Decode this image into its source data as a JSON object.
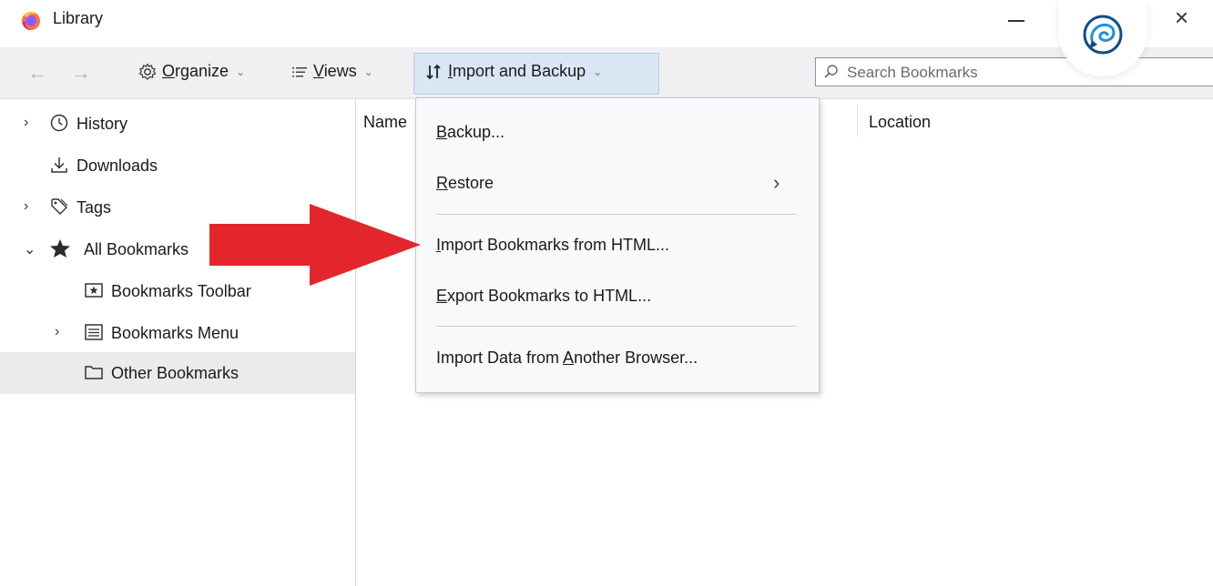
{
  "window": {
    "title": "Library",
    "app_icon": "firefox-icon",
    "controls": {
      "minimize": "minimize-icon",
      "close": "×"
    },
    "assistant_badge_icon": "assistant-chat-icon"
  },
  "toolbar": {
    "back_icon": "←",
    "forward_icon": "→",
    "organize": {
      "icon": "gear-icon",
      "label_first": "O",
      "label_rest": "rganize",
      "caret": "⌄"
    },
    "views": {
      "icon": "views-list-icon",
      "label_first": "V",
      "label_rest": "iews",
      "caret": "⌄"
    },
    "import_backup": {
      "icon": "sort-arrows-icon",
      "label_first": "I",
      "label_rest": "mport and Backup",
      "caret": "⌄",
      "active": true
    },
    "search": {
      "placeholder": "Search Bookmarks",
      "value": "",
      "icon": "search-icon"
    }
  },
  "sidebar": {
    "items": [
      {
        "label": "History",
        "icon": "clock-icon",
        "twisty": "›",
        "selected": false
      },
      {
        "label": "Downloads",
        "icon": "download-icon",
        "twisty": "",
        "selected": false
      },
      {
        "label": "Tags",
        "icon": "tag-icon",
        "twisty": "›",
        "selected": false
      },
      {
        "label": "All Bookmarks",
        "icon": "star-icon",
        "twisty": "⌄",
        "selected": false
      },
      {
        "label": "Bookmarks Toolbar",
        "icon": "toolbar-icon",
        "twisty": "",
        "selected": false
      },
      {
        "label": "Bookmarks Menu",
        "icon": "menu-list-icon",
        "twisty": "›",
        "selected": false
      },
      {
        "label": "Other Bookmarks",
        "icon": "folder-icon",
        "twisty": "",
        "selected": true
      }
    ]
  },
  "content": {
    "columns": [
      "Name",
      "Location"
    ]
  },
  "menu": {
    "items": [
      {
        "label_first": "B",
        "label_rest": "ackup...",
        "has_submenu": false
      },
      {
        "label_first": "R",
        "label_rest": "estore",
        "has_submenu": true,
        "arrow": "›"
      },
      {
        "label_first": "I",
        "label_rest": "mport Bookmarks from HTML...",
        "has_submenu": false
      },
      {
        "label_first": "E",
        "label_rest": "xport Bookmarks to HTML...",
        "has_submenu": false
      },
      {
        "label_before": "Import Data from ",
        "label_first": "A",
        "label_rest": "nother Browser...",
        "has_submenu": false
      }
    ]
  },
  "annotation": {
    "arrow_color": "#e3262b"
  }
}
